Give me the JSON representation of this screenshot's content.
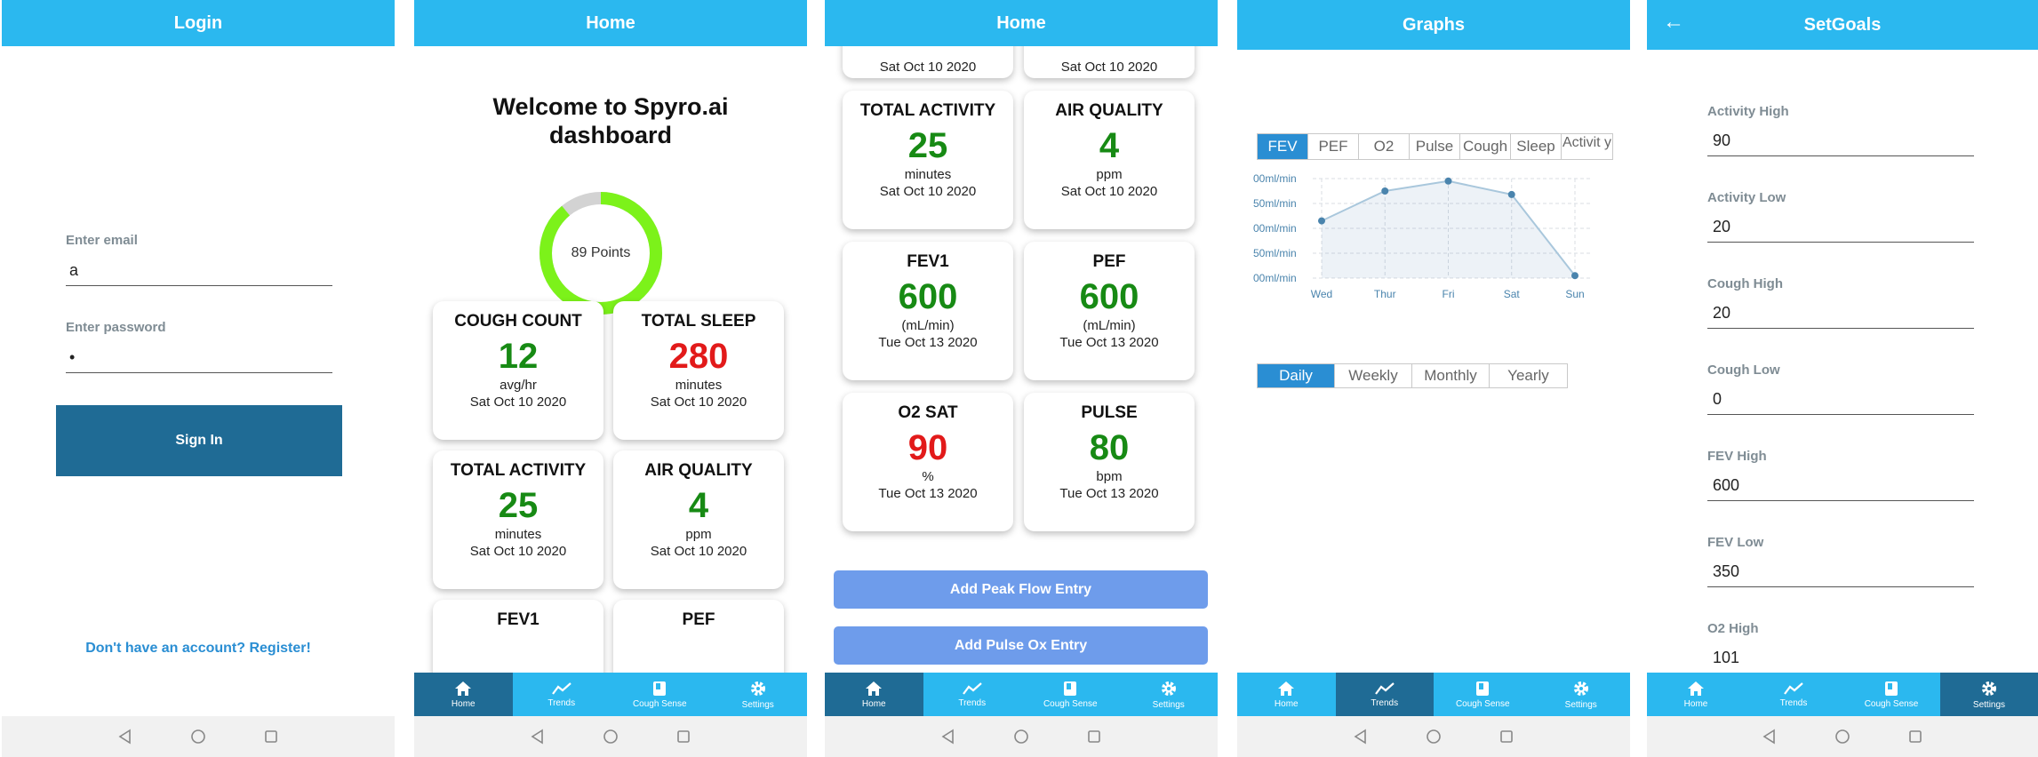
{
  "login": {
    "title": "Login",
    "email_label": "Enter email",
    "email_value": "a",
    "password_label": "Enter password",
    "password_value": "•",
    "signin_label": "Sign In",
    "register_link": "Don't have an account? Register!"
  },
  "home": {
    "title": "Home",
    "welcome": "Welcome to Spyro.ai dashboard",
    "points_label": "89 Points",
    "points_progress": 0.89,
    "cards": [
      {
        "title": "COUGH COUNT",
        "value": "12",
        "unit": "avg/hr",
        "date": "Sat Oct 10 2020",
        "color": "green"
      },
      {
        "title": "TOTAL SLEEP",
        "value": "280",
        "unit": "minutes",
        "date": "Sat Oct 10 2020",
        "color": "red"
      },
      {
        "title": "TOTAL ACTIVITY",
        "value": "25",
        "unit": "minutes",
        "date": "Sat Oct 10 2020",
        "color": "green"
      },
      {
        "title": "AIR QUALITY",
        "value": "4",
        "unit": "ppm",
        "date": "Sat Oct 10 2020",
        "color": "green"
      },
      {
        "title": "FEV1",
        "value": "",
        "unit": "",
        "date": "",
        "color": "green"
      },
      {
        "title": "PEF",
        "value": "",
        "unit": "",
        "date": "",
        "color": "green"
      }
    ]
  },
  "home_scrolled": {
    "title": "Home",
    "partial_date_left": "Sat Oct 10 2020",
    "partial_date_right": "Sat Oct 10 2020",
    "cards": [
      {
        "title": "TOTAL ACTIVITY",
        "value": "25",
        "unit": "minutes",
        "date": "Sat Oct 10 2020",
        "color": "green"
      },
      {
        "title": "AIR QUALITY",
        "value": "4",
        "unit": "ppm",
        "date": "Sat Oct 10 2020",
        "color": "green"
      },
      {
        "title": "FEV1",
        "value": "600",
        "unit": "(mL/min)",
        "date": "Tue Oct 13 2020",
        "color": "green"
      },
      {
        "title": "PEF",
        "value": "600",
        "unit": "(mL/min)",
        "date": "Tue Oct 13 2020",
        "color": "green"
      },
      {
        "title": "O2 SAT",
        "value": "90",
        "unit": "%",
        "date": "Tue Oct 13 2020",
        "color": "red"
      },
      {
        "title": "PULSE",
        "value": "80",
        "unit": "bpm",
        "date": "Tue Oct 13 2020",
        "color": "green"
      }
    ],
    "add_peak_flow": "Add Peak Flow Entry",
    "add_pulse_ox": "Add Pulse Ox Entry"
  },
  "graphs": {
    "title": "Graphs",
    "metric_tabs": [
      "FEV",
      "PEF",
      "O2",
      "Pulse",
      "Cough",
      "Sleep",
      "Activit y"
    ],
    "active_metric": 0,
    "period_tabs": [
      "Daily",
      "Weekly",
      "Monthly",
      "Yearly"
    ],
    "active_period": 0
  },
  "chart_data": {
    "type": "area",
    "categories": [
      "Wed",
      "Thur",
      "Fri",
      "Sat",
      "Sun"
    ],
    "values": [
      465,
      525,
      545,
      518,
      355
    ],
    "y_tick_labels": [
      "00ml/min",
      "50ml/min",
      "00ml/min",
      "50ml/min",
      "00ml/min"
    ],
    "ylim": [
      350,
      550
    ],
    "grid": true,
    "color": "#4a84ad"
  },
  "setgoals": {
    "title": "SetGoals",
    "back_icon": "back-arrow-icon",
    "goals": [
      {
        "label": "Activity High",
        "value": "90"
      },
      {
        "label": "Activity Low",
        "value": "20"
      },
      {
        "label": "Cough High",
        "value": "20"
      },
      {
        "label": "Cough Low",
        "value": "0"
      },
      {
        "label": "FEV High",
        "value": "600"
      },
      {
        "label": "FEV Low",
        "value": "350"
      },
      {
        "label": "O2 High",
        "value": "101"
      }
    ]
  },
  "tabbar": {
    "items": [
      {
        "label": "Home",
        "icon": "home-icon"
      },
      {
        "label": "Trends",
        "icon": "trends-icon"
      },
      {
        "label": "Cough Sense",
        "icon": "cough-sense-icon"
      },
      {
        "label": "Settings",
        "icon": "gear-icon"
      }
    ]
  },
  "colors": {
    "header": "#2bb8ef",
    "primary_dark": "#1f6b95",
    "good": "#178a14",
    "bad": "#e21a1a",
    "button_light": "#6e9ceb"
  }
}
